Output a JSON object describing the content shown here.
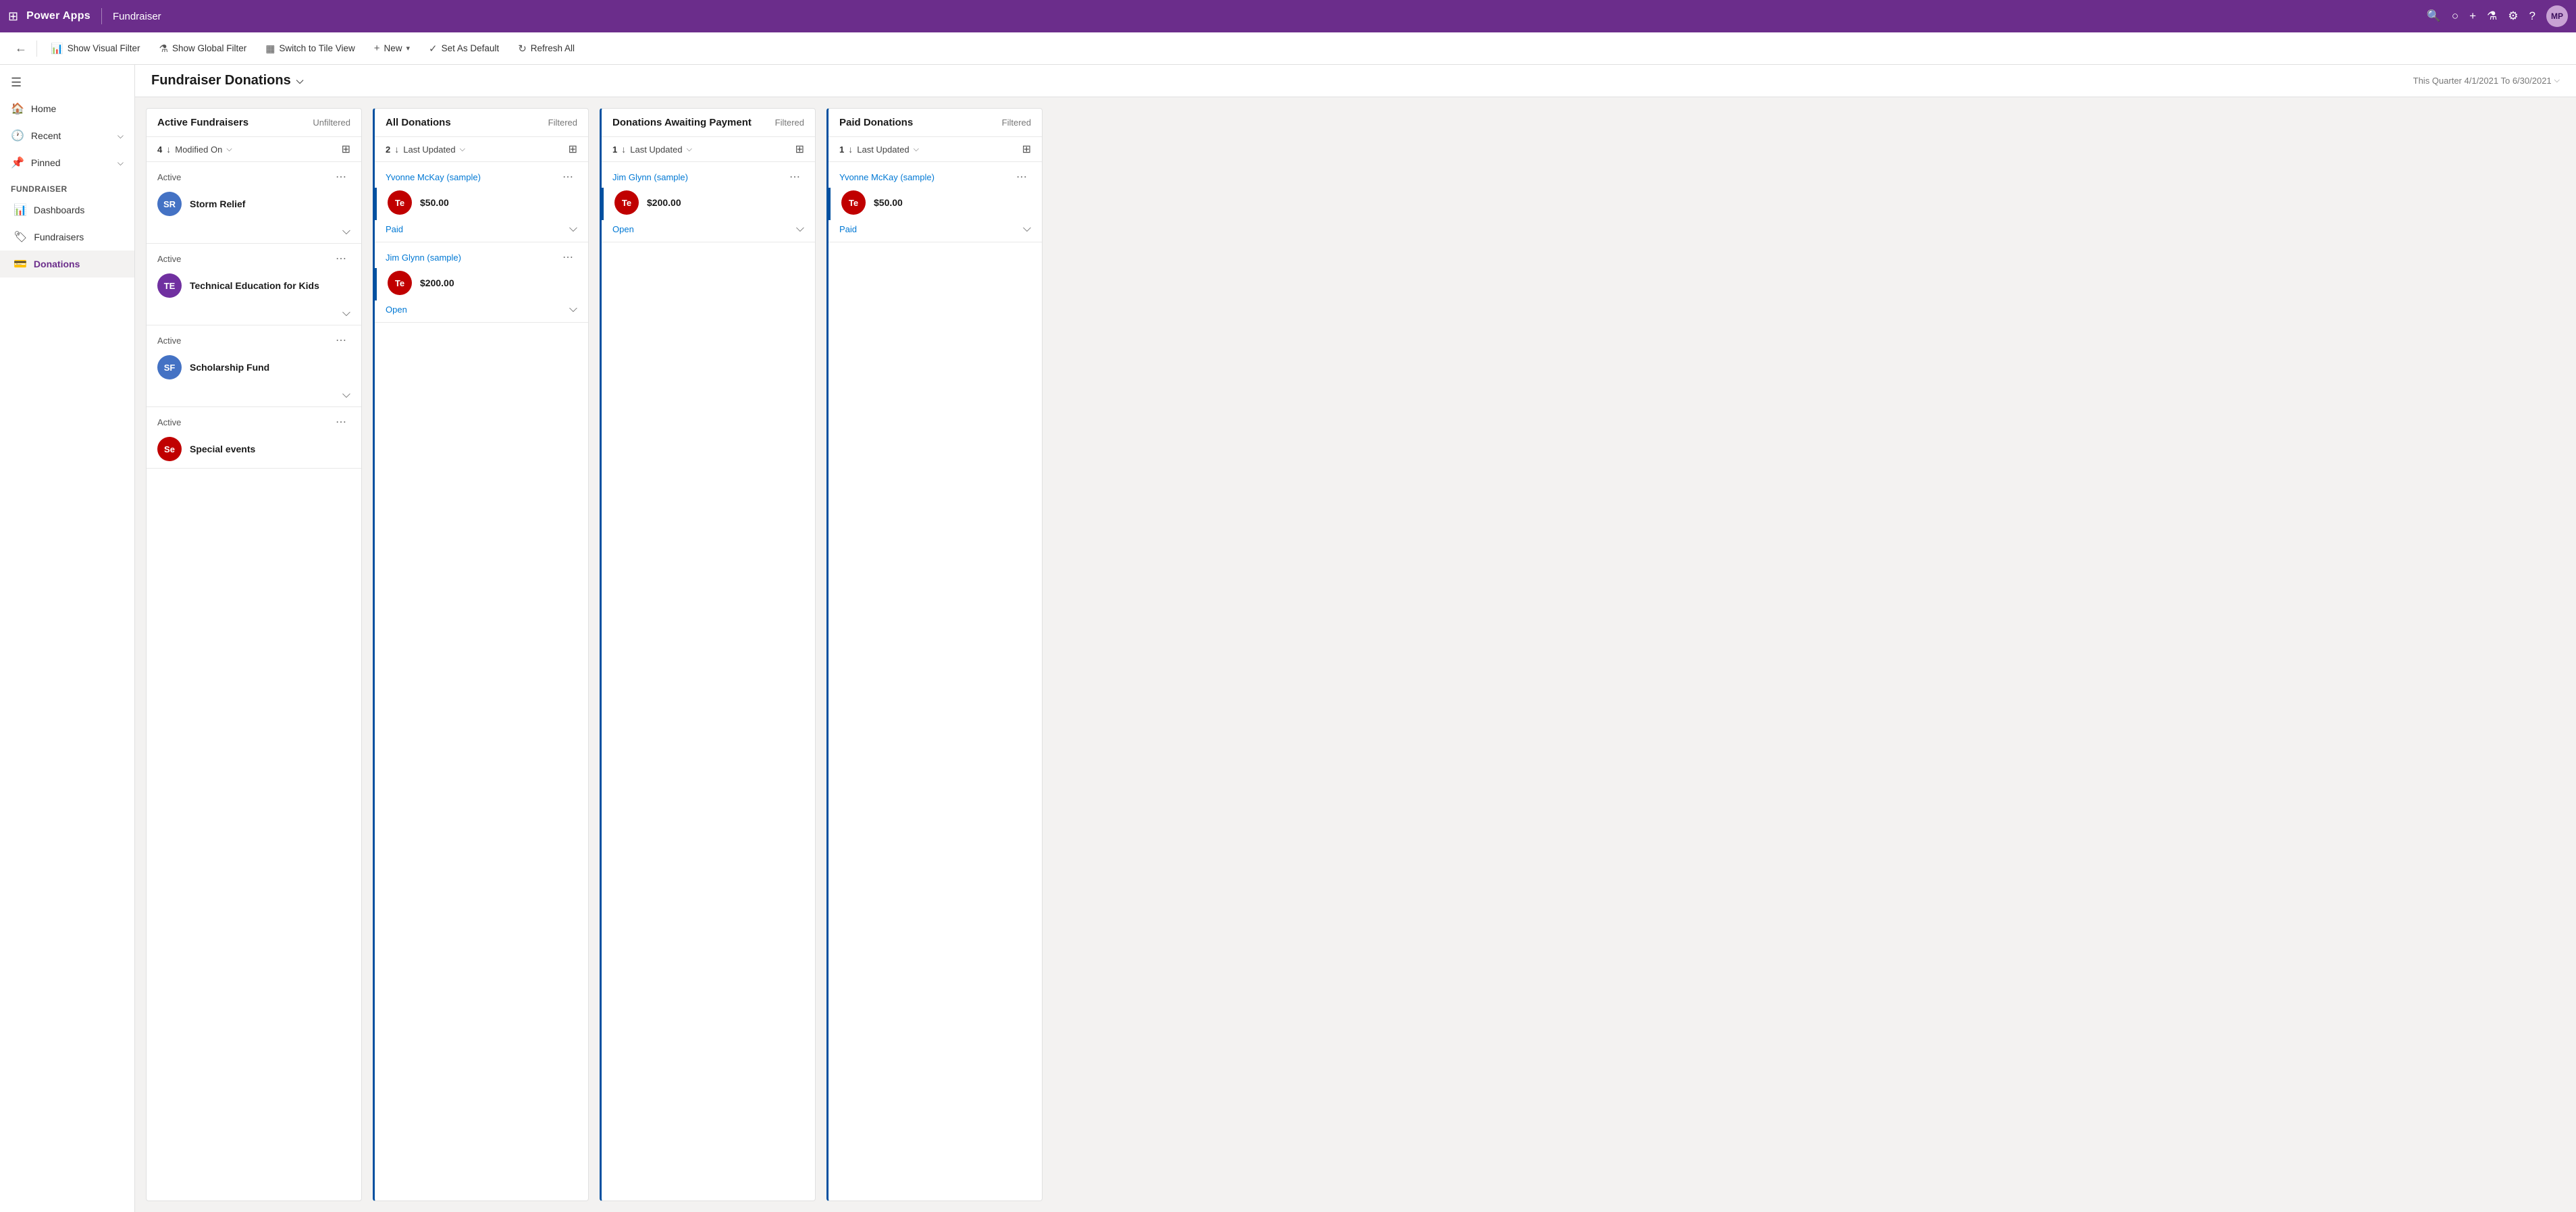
{
  "topBar": {
    "gridIcon": "⊞",
    "logoText": "Power Apps",
    "appName": "Fundraiser",
    "icons": {
      "search": "🔍",
      "circle": "○",
      "plus": "+",
      "filter": "⚗",
      "settings": "⚙",
      "help": "?",
      "avatar": "MP"
    }
  },
  "toolbar": {
    "backIcon": "←",
    "buttons": [
      {
        "id": "show-visual-filter",
        "icon": "📊",
        "label": "Show Visual Filter"
      },
      {
        "id": "show-global-filter",
        "icon": "⚗",
        "label": "Show Global Filter"
      },
      {
        "id": "switch-tile-view",
        "icon": "▦",
        "label": "Switch to Tile View"
      },
      {
        "id": "new",
        "icon": "+",
        "label": "New",
        "hasDropdown": true
      },
      {
        "id": "set-as-default",
        "icon": "✓",
        "label": "Set As Default"
      },
      {
        "id": "refresh-all",
        "icon": "↻",
        "label": "Refresh All"
      }
    ]
  },
  "sidebar": {
    "hamburgerIcon": "☰",
    "navItems": [
      {
        "id": "home",
        "icon": "🏠",
        "label": "Home",
        "hasChevron": false
      },
      {
        "id": "recent",
        "icon": "🕐",
        "label": "Recent",
        "hasChevron": true
      },
      {
        "id": "pinned",
        "icon": "📌",
        "label": "Pinned",
        "hasChevron": true
      }
    ],
    "sectionHeader": "Fundraiser",
    "subItems": [
      {
        "id": "dashboards",
        "icon": "📊",
        "label": "Dashboards",
        "active": false
      },
      {
        "id": "fundraisers",
        "icon": "🏷",
        "label": "Fundraisers",
        "active": false
      },
      {
        "id": "donations",
        "icon": "💳",
        "label": "Donations",
        "active": true
      }
    ]
  },
  "pageHeader": {
    "title": "Fundraiser Donations",
    "dropdownIcon": "⌵",
    "dateRange": "This Quarter 4/1/2021 To 6/30/2021",
    "dateChevron": "⌵"
  },
  "lanes": [
    {
      "id": "active-fundraisers",
      "title": "Active Fundraisers",
      "filterLabel": "Unfiltered",
      "sortCount": "4",
      "sortField": "Modified On",
      "hasAccent": false,
      "cards": [
        {
          "status": "Active",
          "avatarText": "SR",
          "avatarColor": "#4472c4",
          "name": "Storm Relief"
        },
        {
          "status": "Active",
          "avatarText": "TE",
          "avatarColor": "#7030a0",
          "name": "Technical Education for Kids"
        },
        {
          "status": "Active",
          "avatarText": "SF",
          "avatarColor": "#4472c4",
          "name": "Scholarship Fund"
        },
        {
          "status": "Active",
          "avatarText": "Se",
          "avatarColor": "#c00000",
          "name": "Special events"
        }
      ]
    },
    {
      "id": "all-donations",
      "title": "All Donations",
      "filterLabel": "Filtered",
      "sortCount": "2",
      "sortField": "Last Updated",
      "hasAccent": true,
      "donationCards": [
        {
          "contactName": "Yvonne McKay (sample)",
          "avatarText": "Te",
          "avatarColor": "#c00000",
          "amount": "$50.00",
          "statusLabel": "Paid",
          "statusColor": "link"
        },
        {
          "contactName": "Jim Glynn (sample)",
          "avatarText": "Te",
          "avatarColor": "#c00000",
          "amount": "$200.00",
          "statusLabel": "Open",
          "statusColor": "link"
        }
      ]
    },
    {
      "id": "donations-awaiting-payment",
      "title": "Donations Awaiting Payment",
      "filterLabel": "Filtered",
      "sortCount": "1",
      "sortField": "Last Updated",
      "hasAccent": true,
      "donationCards": [
        {
          "contactName": "Jim Glynn (sample)",
          "avatarText": "Te",
          "avatarColor": "#c00000",
          "amount": "$200.00",
          "statusLabel": "Open",
          "statusColor": "link"
        }
      ]
    },
    {
      "id": "paid-donations",
      "title": "Paid Donations",
      "filterLabel": "Filtered",
      "sortCount": "1",
      "sortField": "Last Updated",
      "hasAccent": true,
      "donationCards": [
        {
          "contactName": "Yvonne McKay (sample)",
          "avatarText": "Te",
          "avatarColor": "#c00000",
          "amount": "$50.00",
          "statusLabel": "Paid",
          "statusColor": "link"
        }
      ]
    }
  ]
}
